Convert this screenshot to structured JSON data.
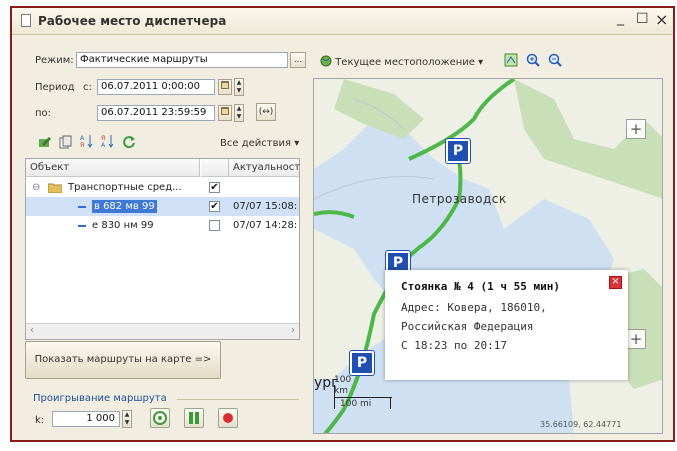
{
  "window": {
    "title": "Рабочее место диспетчера",
    "minimize": "_",
    "maximize": "☐",
    "close": "×"
  },
  "form": {
    "mode_label": "Режим:",
    "mode_value": "Фактические маршруты",
    "mode_button": "...",
    "period_label": "Период",
    "from_label": "с:",
    "from_value": "06.07.2011  0:00:00",
    "to_label": "по:",
    "to_value": "06.07.2011 23:59:59",
    "period_button": "(↔)"
  },
  "toolbar": {
    "all_actions": "Все действия",
    "icons": [
      "edit-icon",
      "copy-icon",
      "sort-asc-icon",
      "sort-desc-icon",
      "refresh-icon"
    ]
  },
  "tree": {
    "columns": [
      "Объект",
      "Актуальност"
    ],
    "rows": [
      {
        "name": "Транспортные сред...",
        "checked": true,
        "time": "",
        "type": "folder"
      },
      {
        "name": "в 682 мв 99",
        "checked": true,
        "time": "07/07 15:08:",
        "type": "vehicle",
        "selected": true
      },
      {
        "name": "е 830 нм 99",
        "checked": false,
        "time": "07/07 14:28:",
        "type": "vehicle"
      }
    ]
  },
  "show_routes_button": "Показать маршруты на карте =>",
  "playback": {
    "section_label": "Проигрывание маршрута",
    "k_label": "k:",
    "k_value": "1 000"
  },
  "map_toolbar": {
    "current_location": "Текущее местоположение",
    "icons": [
      "layers-icon",
      "zoom-in-icon",
      "zoom-out-icon"
    ]
  },
  "map": {
    "city_label": "Петрозаводск",
    "partial_city_label": "ург",
    "zoom_in": "+",
    "zoom_in_lower": "+",
    "scale_top": "100",
    "scale_km": "km",
    "scale_mi": "100 mi",
    "coords": "35.66109, 62.44771",
    "popup": {
      "title": "Стоянка № 4 (1 ч 55 мин)",
      "line1": "Адрес: Ковера, 186010,",
      "line2": "Российская Федерация",
      "line3": "С 18:23 по 20:17",
      "close": "×"
    },
    "markers": [
      "parking-marker-north",
      "parking-marker-middle",
      "parking-marker-south"
    ],
    "marker_letter": "P",
    "colors": {
      "water": "#cfe0f2",
      "land": "#eef0e6",
      "forest": "#c9dfb8",
      "route": "#4db848"
    }
  }
}
